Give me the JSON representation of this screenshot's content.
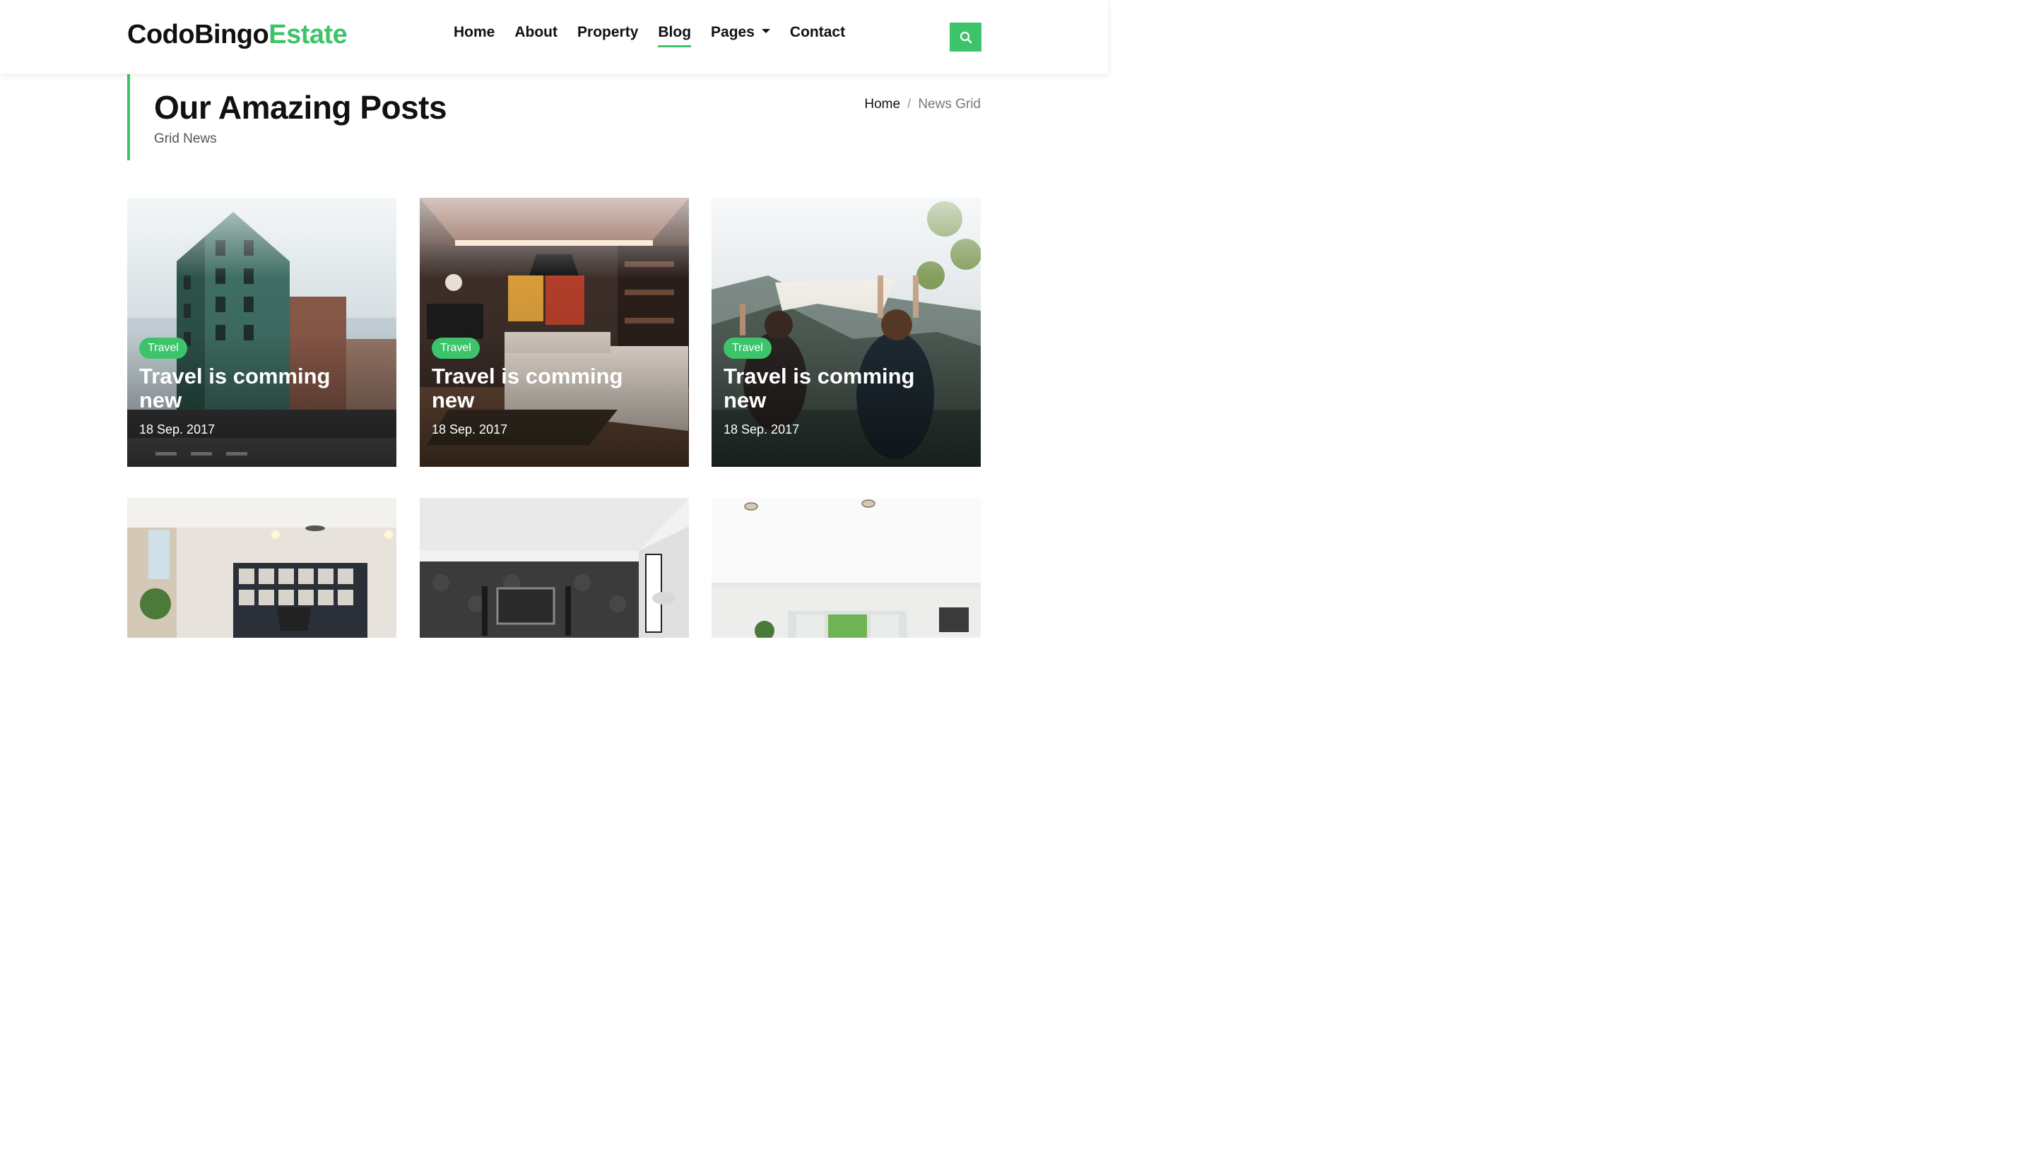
{
  "header": {
    "logo_main": "CodoBingo",
    "logo_accent": "Estate",
    "nav": [
      {
        "label": "Home"
      },
      {
        "label": "About"
      },
      {
        "label": "Property"
      },
      {
        "label": "Blog"
      },
      {
        "label": "Pages"
      },
      {
        "label": "Contact"
      }
    ],
    "active_nav": "Blog"
  },
  "page": {
    "title": "Our Amazing Posts",
    "subtitle": "Grid News"
  },
  "breadcrumb": {
    "home": "Home",
    "separator": "/",
    "current": "News Grid"
  },
  "posts": [
    {
      "tag": "Travel",
      "title": "Travel is comming new",
      "date": "18 Sep. 2017",
      "image": "city-building-street"
    },
    {
      "tag": "Travel",
      "title": "Travel is comming new",
      "date": "18 Sep. 2017",
      "image": "living-room-interior"
    },
    {
      "tag": "Travel",
      "title": "Travel is comming new",
      "date": "18 Sep. 2017",
      "image": "women-cliff-lake"
    },
    {
      "image": "room-with-shelves"
    },
    {
      "image": "room-with-tv-wall"
    },
    {
      "image": "bright-empty-room"
    }
  ],
  "colors": {
    "accent": "#3dc46a",
    "text": "#111111",
    "muted": "#777777"
  }
}
